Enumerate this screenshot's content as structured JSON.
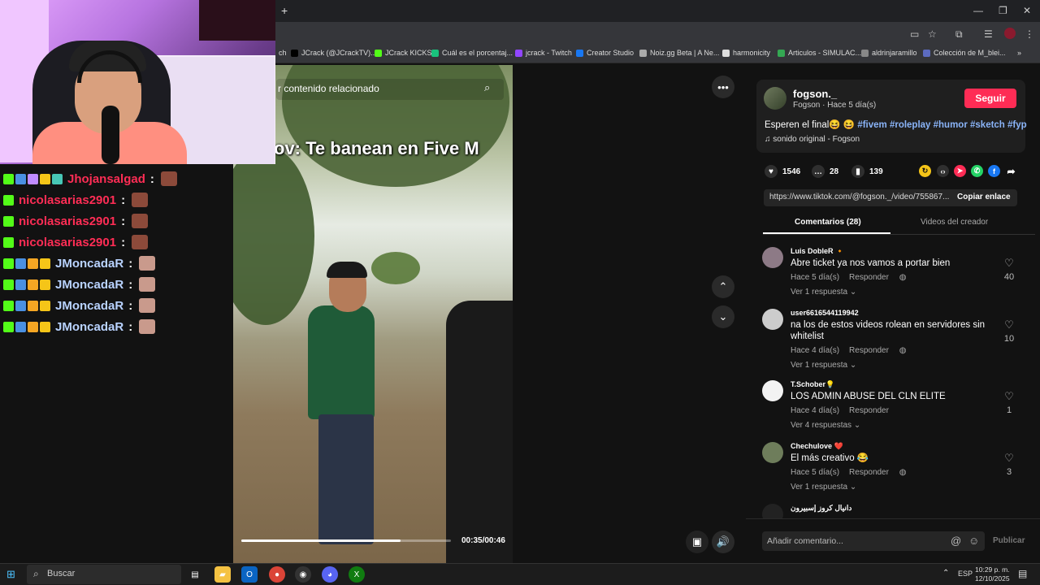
{
  "bookmarks": [
    {
      "label": "ch",
      "color": "#888888"
    },
    {
      "label": "JCrack (@JCrackTV)...",
      "color": "#000000"
    },
    {
      "label": "JCrack KICKS",
      "color": "#53fc18"
    },
    {
      "label": "Cuál es el porcentaj...",
      "color": "#19c37d"
    },
    {
      "label": "jcrack - Twitch",
      "color": "#9146ff"
    },
    {
      "label": "Creator Studio",
      "color": "#1877f2"
    },
    {
      "label": "Noiz.gg Beta | A Ne...",
      "color": "#aaaaaa"
    },
    {
      "label": "harmonicity",
      "color": "#dddddd"
    },
    {
      "label": "Articulos - SIMULAC...",
      "color": "#34a853"
    },
    {
      "label": "aldrinjaramillo",
      "color": "#888888"
    },
    {
      "label": "Colección de M_blei...",
      "color": "#5c6bc0"
    }
  ],
  "chat": [
    {
      "user": "Jhojansalgad",
      "color": "#ff2d55"
    },
    {
      "user": "nicolasarias2901",
      "color": "#ff2d55"
    },
    {
      "user": "nicolasarias2901",
      "color": "#ff2d55"
    },
    {
      "user": "nicolasarias2901",
      "color": "#ff2d55"
    },
    {
      "user": "JMoncadaR",
      "color": "#b9d3ff"
    },
    {
      "user": "JMoncadaR",
      "color": "#b9d3ff"
    },
    {
      "user": "JMoncadaR",
      "color": "#b9d3ff"
    },
    {
      "user": "JMoncadaR",
      "color": "#b9d3ff"
    }
  ],
  "video": {
    "search_placeholder": "r contenido relacionado",
    "caption": "ov: Te banean en Five M",
    "time": "00:35/00:46",
    "progress": 0.76
  },
  "author": {
    "name": "fogson._",
    "sub": "Fogson · Hace 5 día(s)",
    "follow_label": "Seguir",
    "desc_text": "Esperen el final😆 😆",
    "desc_tags": "#fivem #roleplay #humor #sketch #fyp",
    "sound": "♫  sonido original - Fogson"
  },
  "stats": {
    "likes": "1546",
    "comments": "28",
    "saves": "139"
  },
  "link": {
    "url": "https://www.tiktok.com/@fogson._/video/755867...",
    "copy_label": "Copiar enlace"
  },
  "tabs": {
    "comments": "Comentarios (28)",
    "creator_videos": "Videos del creador"
  },
  "comments": [
    {
      "user": "Luis DobleR 🔸",
      "text": "Abre ticket ya nos vamos a portar bien",
      "time": "Hace 5 día(s)",
      "reply": "Responder",
      "more": "Ver 1 respuesta ⌄",
      "likes": "40",
      "avatar": "#8d7a86"
    },
    {
      "user": "user6616544119942",
      "text": "na los de estos videos rolean en servidores sin whitelist",
      "time": "Hace 4 día(s)",
      "reply": "Responder",
      "more": "Ver 1 respuesta ⌄",
      "likes": "10",
      "avatar": "#cccccc"
    },
    {
      "user": "T.Schober💡",
      "text": "LOS ADMIN ABUSE DEL CLN ELITE",
      "time": "Hace 4 día(s)",
      "reply": "Responder",
      "more": "Ver 4 respuestas ⌄",
      "likes": "1",
      "avatar": "#f2f2f2"
    },
    {
      "user": "Chechulove ❤️",
      "text": "El más creativo 😂",
      "time": "Hace 5 día(s)",
      "reply": "Responder",
      "more": "Ver 1 respuesta ⌄",
      "likes": "3",
      "avatar": "#6e7d5b"
    },
    {
      "user": "دانيال كروز إسبيرون",
      "text": "",
      "time": "",
      "reply": "",
      "more": "",
      "likes": "",
      "avatar": "#222222"
    }
  ],
  "comment_input": {
    "placeholder": "Añadir comentario...",
    "publish_label": "Publicar"
  },
  "taskbar": {
    "search_placeholder": "Buscar",
    "lang": "ESP",
    "time": "10:29 p. m.",
    "date": "12/10/2025"
  }
}
